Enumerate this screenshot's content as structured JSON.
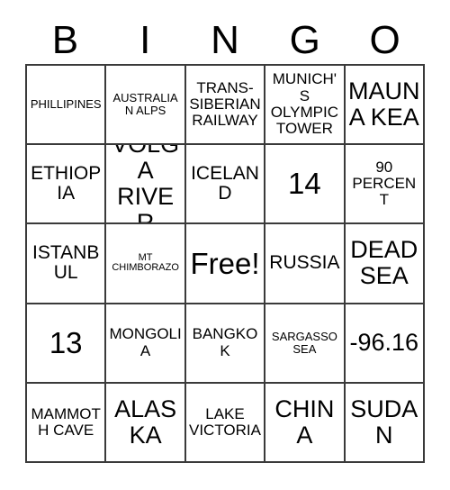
{
  "card": {
    "type": "bingo-card",
    "header_letters": [
      "B",
      "I",
      "N",
      "G",
      "O"
    ],
    "grid_size": "5x5",
    "free_space_label": "Free!",
    "colors": {
      "background": "#ffffff",
      "border": "#3a3a3a",
      "text": "#000000"
    },
    "columns": [
      {
        "letter": "B",
        "cells": [
          {
            "text": "PHILLIPINES",
            "size": "sm"
          },
          {
            "text": "ETHIOPIA",
            "size": "lg"
          },
          {
            "text": "ISTANBUL",
            "size": "lg"
          },
          {
            "text": "13",
            "size": "xxl"
          },
          {
            "text": "MAMMOTH CAVE",
            "size": "md"
          }
        ]
      },
      {
        "letter": "I",
        "cells": [
          {
            "text": "AUSTRALIAN ALPS",
            "size": "sm"
          },
          {
            "text": "VOLGA RIVER",
            "size": "xl"
          },
          {
            "text": "MT CHIMBORAZO",
            "size": "xs"
          },
          {
            "text": "MONGOLIA",
            "size": "md"
          },
          {
            "text": "ALASKA",
            "size": "xl"
          }
        ]
      },
      {
        "letter": "N",
        "cells": [
          {
            "text": "TRANS-SIBERIAN RAILWAY",
            "size": "md"
          },
          {
            "text": "ICELAND",
            "size": "lg"
          },
          {
            "text": "Free!",
            "size": "xxl"
          },
          {
            "text": "BANGKOK",
            "size": "md"
          },
          {
            "text": "LAKE VICTORIA",
            "size": "md"
          }
        ]
      },
      {
        "letter": "G",
        "cells": [
          {
            "text": "MUNICH'S OLYMPIC TOWER",
            "size": "md"
          },
          {
            "text": "14",
            "size": "xxl"
          },
          {
            "text": "RUSSIA",
            "size": "lg"
          },
          {
            "text": "SARGASSO SEA",
            "size": "sm"
          },
          {
            "text": "CHINA",
            "size": "xl"
          }
        ]
      },
      {
        "letter": "O",
        "cells": [
          {
            "text": "MAUNA KEA",
            "size": "xl"
          },
          {
            "text": "90 PERCENT",
            "size": "md"
          },
          {
            "text": "DEAD SEA",
            "size": "xl"
          },
          {
            "text": "-96.16",
            "size": "xl"
          },
          {
            "text": "SUDAN",
            "size": "xl"
          }
        ]
      }
    ]
  }
}
